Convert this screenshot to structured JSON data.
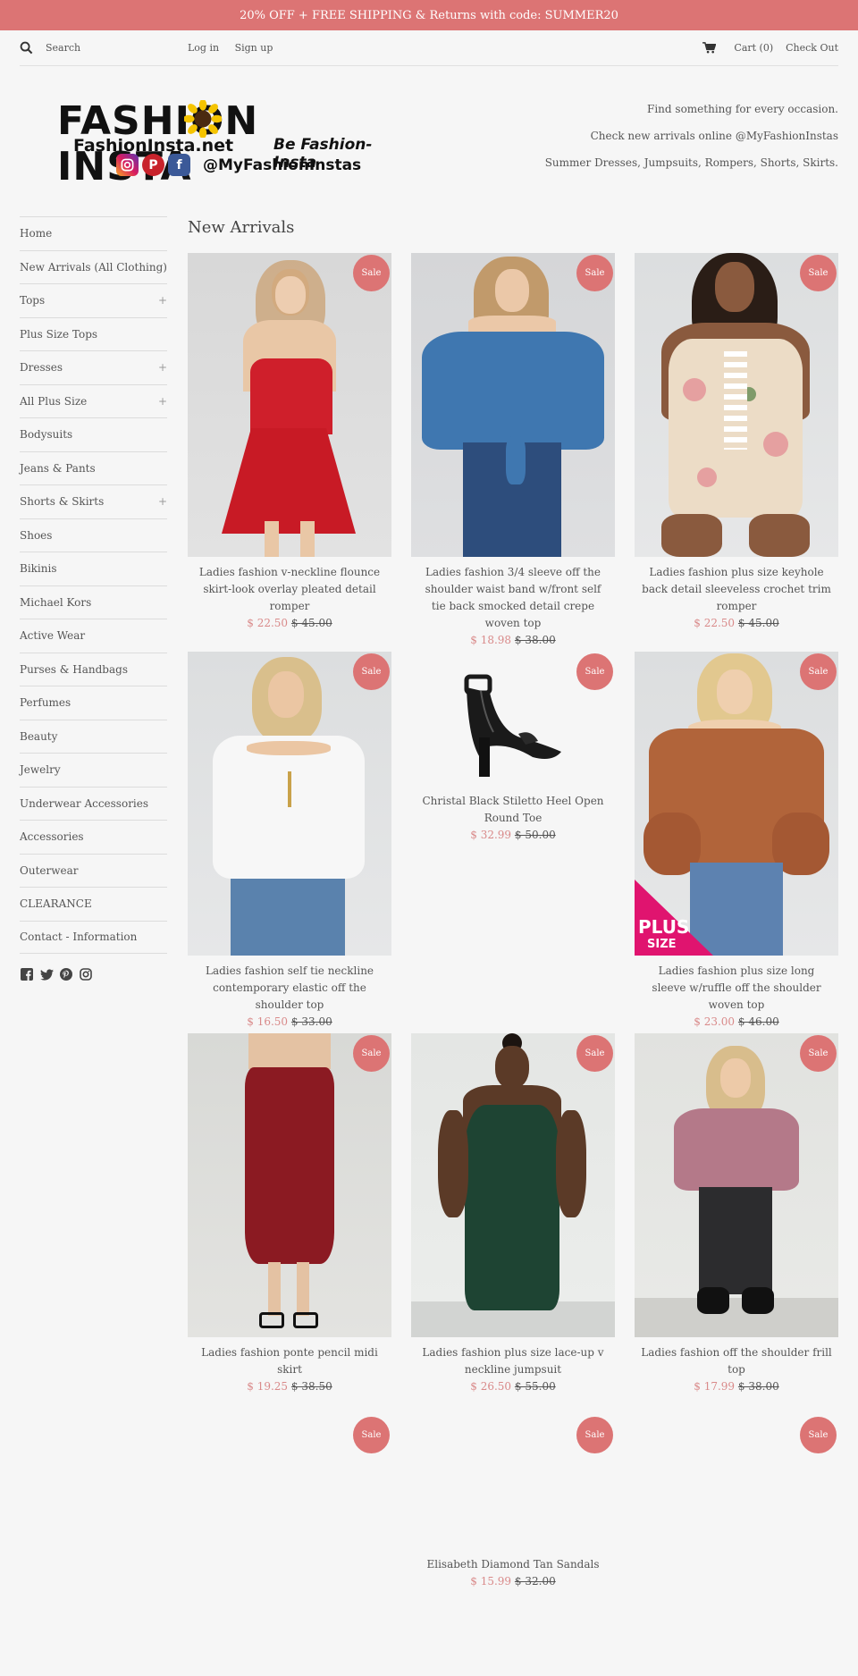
{
  "promo": "20% OFF + FREE SHIPPING & Returns with code: SUMMER20",
  "topbar": {
    "search": "Search",
    "login": "Log in",
    "signup": "Sign up",
    "cart": "Cart (0)",
    "checkout": "Check Out"
  },
  "logo": {
    "title": "FASHION INSTA",
    "site": "FashionInsta.net",
    "slogan": "Be Fashion-Insta",
    "handle": "@MyFashionInstas"
  },
  "taglines": [
    "Find something for every occasion.",
    "Check new arrivals online @MyFashionInstas",
    "Summer Dresses, Jumpsuits, Rompers, Shorts, Skirts."
  ],
  "sidebar": [
    "Home",
    "New Arrivals (All Clothing)",
    "Tops",
    "Plus Size Tops",
    "Dresses",
    "All Plus Size",
    "Bodysuits",
    "Jeans & Pants",
    "Shorts & Skirts",
    "Shoes",
    "Bikinis",
    "Michael Kors",
    "Active Wear",
    "Purses & Handbags",
    "Perfumes",
    "Beauty",
    "Jewelry",
    "Underwear Accessories",
    "Accessories",
    "Outerwear",
    "CLEARANCE",
    "Contact - Information"
  ],
  "section_title": "New Arrivals",
  "sale_label": "Sale",
  "plus_label": "PLUS",
  "size_label": "SIZE",
  "products": [
    {
      "name": "Ladies fashion v-neckline flounce skirt-look overlay pleated detail romper",
      "price": "$ 22.50",
      "was": "$ 45.00"
    },
    {
      "name": "Ladies fashion 3/4 sleeve off the shoulder waist band w/front self tie back smocked detail crepe woven top",
      "price": "$ 18.98",
      "was": "$ 38.00"
    },
    {
      "name": "Ladies fashion plus size keyhole back detail sleeveless crochet trim romper",
      "price": "$ 22.50",
      "was": "$ 45.00"
    },
    {
      "name": "Ladies fashion self tie neckline contemporary elastic off the shoulder top",
      "price": "$ 16.50",
      "was": "$ 33.00"
    },
    {
      "name": "Christal Black Stiletto Heel Open Round Toe",
      "price": "$ 32.99",
      "was": "$ 50.00"
    },
    {
      "name": "Ladies fashion plus size long sleeve w/ruffle off the shoulder woven top",
      "price": "$ 23.00",
      "was": "$ 46.00"
    },
    {
      "name": "Ladies fashion ponte pencil midi skirt",
      "price": "$ 19.25",
      "was": "$ 38.50"
    },
    {
      "name": "Ladies fashion plus size lace-up v neckline jumpsuit",
      "price": "$ 26.50",
      "was": "$ 55.00"
    },
    {
      "name": "Ladies fashion off the shoulder frill top",
      "price": "$ 17.99",
      "was": "$ 38.00"
    },
    {
      "name": "",
      "price": "",
      "was": ""
    },
    {
      "name": "Elisabeth Diamond Tan Sandals",
      "price": "$ 15.99",
      "was": "$ 32.00"
    },
    {
      "name": "",
      "price": "",
      "was": ""
    }
  ]
}
